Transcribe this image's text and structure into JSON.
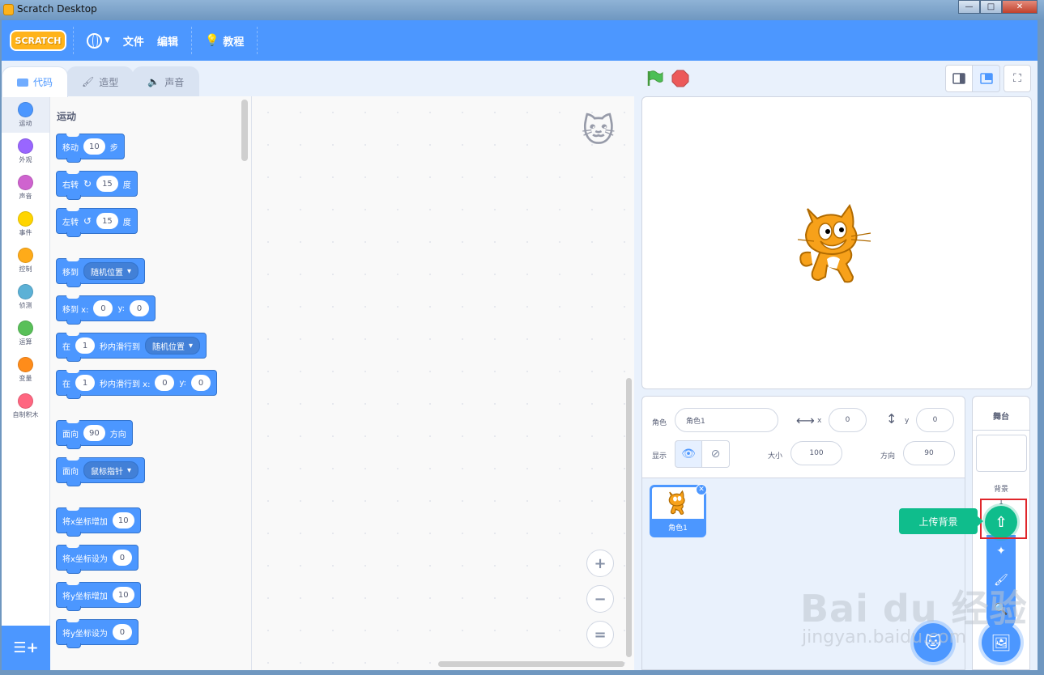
{
  "window": {
    "title": "Scratch Desktop"
  },
  "menubar": {
    "logo": "SCRATCH",
    "file": "文件",
    "edit": "编辑",
    "tutorials": "教程"
  },
  "tabs": [
    {
      "label": "代码",
      "icon": "code-icon"
    },
    {
      "label": "造型",
      "icon": "brush-icon"
    },
    {
      "label": "声音",
      "icon": "speaker-icon"
    }
  ],
  "categories": [
    {
      "label": "运动",
      "color": "#4c97ff"
    },
    {
      "label": "外观",
      "color": "#9966ff"
    },
    {
      "label": "声音",
      "color": "#cf63cf"
    },
    {
      "label": "事件",
      "color": "#ffd500"
    },
    {
      "label": "控制",
      "color": "#ffab19"
    },
    {
      "label": "侦测",
      "color": "#5cb1d6"
    },
    {
      "label": "运算",
      "color": "#59c059"
    },
    {
      "label": "变量",
      "color": "#ff8c1a"
    },
    {
      "label": "自制积木",
      "color": "#ff6680"
    }
  ],
  "palette": {
    "section": "运动",
    "blocks": {
      "move": {
        "text": "移动",
        "value": "10",
        "unit": "步"
      },
      "turn_right": {
        "text": "右转",
        "value": "15",
        "unit": "度"
      },
      "turn_left": {
        "text": "左转",
        "value": "15",
        "unit": "度"
      },
      "goto": {
        "text": "移到",
        "option": "随机位置"
      },
      "goto_xy": {
        "text": "移到 x:",
        "x": "0",
        "y_label": "y:",
        "y": "0"
      },
      "glide": {
        "prefix": "在",
        "secs": "1",
        "text": "秒内滑行到",
        "option": "随机位置"
      },
      "glide_xy": {
        "prefix": "在",
        "secs": "1",
        "text": "秒内滑行到 x:",
        "x": "0",
        "y_label": "y:",
        "y": "0"
      },
      "point_dir": {
        "text": "面向",
        "value": "90",
        "unit": "方向"
      },
      "point_toward": {
        "text": "面向",
        "option": "鼠标指针"
      },
      "change_x": {
        "text": "将x坐标增加",
        "value": "10"
      },
      "set_x": {
        "text": "将x坐标设为",
        "value": "0"
      },
      "change_y": {
        "text": "将y坐标增加",
        "value": "10"
      },
      "set_y": {
        "text": "将y坐标设为",
        "value": "0"
      }
    }
  },
  "code_area": {
    "zoom_in": "+",
    "zoom_out": "−",
    "zoom_reset": "="
  },
  "sprite_info": {
    "sprite_label": "角色",
    "sprite_name": "角色1",
    "x_label": "x",
    "x": "0",
    "y_label": "y",
    "y": "0",
    "show_label": "显示",
    "size_label": "大小",
    "size": "100",
    "direction_label": "方向",
    "direction": "90"
  },
  "sprites": [
    {
      "name": "角色1"
    }
  ],
  "stage_target": {
    "title": "舞台",
    "backdrops_label": "背景",
    "backdrops_count": "1"
  },
  "backdrop_menu": {
    "tooltip": "上传背景",
    "items": [
      "upload-icon",
      "surprise-icon",
      "paint-icon",
      "search-icon"
    ]
  },
  "watermark": {
    "main": "Bai du 经验",
    "sub": "jingyan.baidu.com"
  },
  "colors": {
    "menubar": "#4c97ff",
    "motion": "#4c97ff",
    "accent_green": "#0fbd8c",
    "highlight_red": "#e0262b"
  }
}
